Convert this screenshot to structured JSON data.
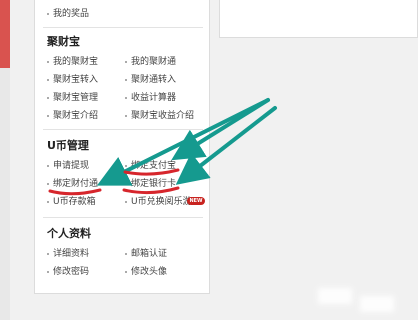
{
  "sidebar": {
    "top_item": "我的奖品",
    "juCaiBao": {
      "title": "聚财宝",
      "links": [
        "我的聚财宝",
        "我的聚财通",
        "聚财宝转入",
        "聚财通转入",
        "聚财宝管理",
        "收益计算器",
        "聚财宝介绍",
        "聚财宝收益介绍"
      ]
    },
    "uCoin": {
      "title": "U币管理",
      "links": [
        "申请提现",
        "绑定支付宝",
        "绑定财付通",
        "绑定银行卡",
        "U币存款箱",
        "U币兑换阅乐游"
      ],
      "badge": "NEW"
    },
    "profile": {
      "title": "个人资料",
      "links": [
        "详细资料",
        "邮箱认证",
        "修改密码",
        "修改头像"
      ]
    }
  },
  "annotations": {
    "arrow_color": "#159a8f",
    "underline_color": "#d6262c"
  }
}
